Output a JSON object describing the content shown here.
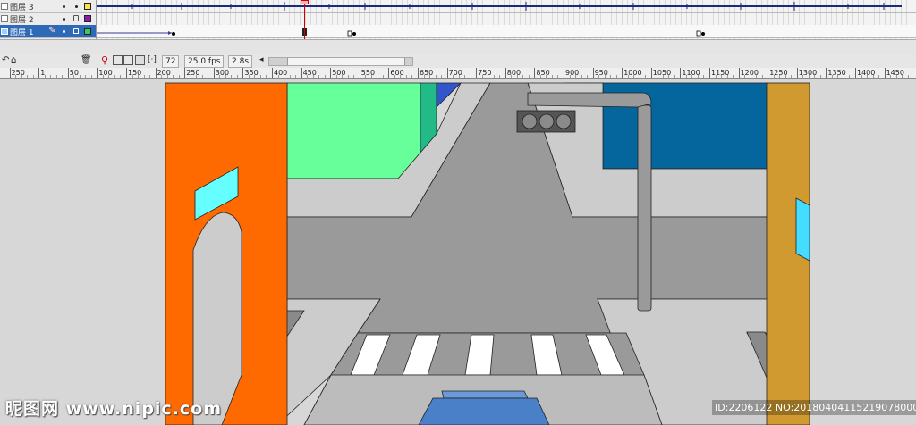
{
  "layers": [
    {
      "name": "图层 3",
      "color": "#f5e34a",
      "selected": false
    },
    {
      "name": "图层 2",
      "color": "#8b1fa8",
      "selected": false
    },
    {
      "name": "图层 1",
      "color": "#33cc66",
      "selected": true
    }
  ],
  "timeline": {
    "current_frame": "72",
    "frame_rate": "25.0 fps",
    "elapsed_time": "2.8s"
  },
  "ruler": {
    "ticks": [
      "200",
      "250",
      "1",
      "50",
      "100",
      "150",
      "200",
      "250",
      "300",
      "350",
      "400",
      "450",
      "500",
      "550",
      "600",
      "650",
      "700",
      "750",
      "800",
      "850",
      "900",
      "950",
      "1000",
      "1050",
      "1100",
      "1150",
      "1200",
      "1250",
      "1300",
      "1350",
      "1400",
      "1450"
    ]
  },
  "colors": {
    "sky": "#d7d7d7",
    "road": "#9a9a9a",
    "left_building": "#ff6a00",
    "right_building": "#d09a30",
    "green_building": "#66ff99",
    "blue_building": "#05659d",
    "window": "#66ffff",
    "car": "#4a80c8"
  },
  "watermarks": {
    "left": "昵图网 www.nipic.com",
    "right": "ID:2206122 NO:20180404115219078000"
  }
}
